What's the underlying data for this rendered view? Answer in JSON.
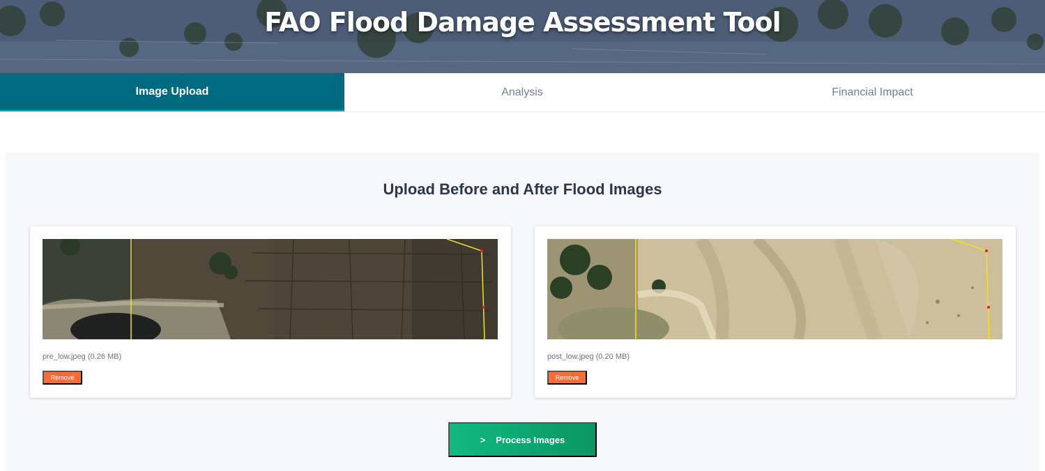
{
  "header": {
    "title": "FAO Flood Damage Assessment Tool"
  },
  "tabs": [
    {
      "label": "Image Upload",
      "active": true
    },
    {
      "label": "Analysis",
      "active": false
    },
    {
      "label": "Financial Impact",
      "active": false
    }
  ],
  "upload": {
    "heading": "Upload Before and After Flood Images",
    "before": {
      "file_label": "pre_low.jpeg (0.26 MB)",
      "remove_label": "Remove"
    },
    "after": {
      "file_label": "post_low.jpeg (0.20 MB)",
      "remove_label": "Remove"
    },
    "process_icon": ">",
    "process_label": "Process Images"
  },
  "colors": {
    "tab_active": "#006b80",
    "remove_button": "#ff6b35",
    "process_button": "#12b981",
    "boundary_line": "#f5e21c"
  }
}
